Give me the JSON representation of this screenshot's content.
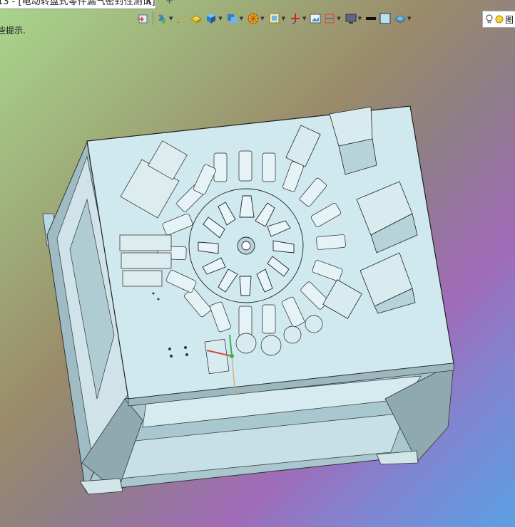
{
  "document_tab": {
    "title": "13 - [电动转盘式零件漏气密封性测试]",
    "close_symbol": "✕",
    "add_symbol": "+"
  },
  "toolbar": {
    "icons": [
      "save-icon",
      "fill-icon",
      "pen-icon",
      "cube-yellow-icon",
      "cube-blue-icon",
      "cube-stack-icon",
      "wheel-icon",
      "view-orient-icon",
      "axis-icon",
      "image-icon",
      "section-icon",
      "monitor-icon",
      "line-icon",
      "box-icon",
      "layer-icon"
    ],
    "view_label": "图"
  },
  "hint": {
    "text": "些提示."
  },
  "viewport": {
    "background_colors": [
      "#a8d68c",
      "#9a8a6a",
      "#a06bb8",
      "#5a9fe4"
    ],
    "model_color": "#cfe9ef",
    "frame_color": "#8fa9b0"
  }
}
